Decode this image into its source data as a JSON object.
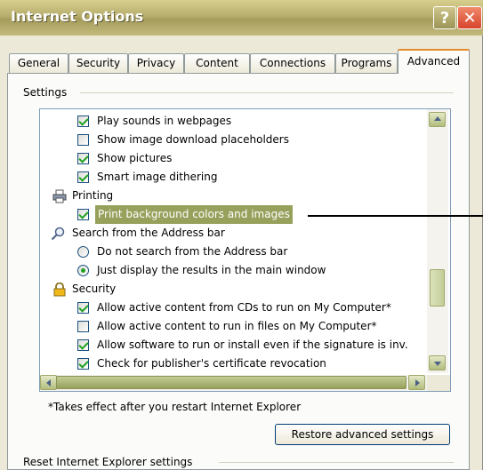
{
  "window": {
    "title": "Internet Options"
  },
  "titlebar_buttons": {
    "help_label": "?",
    "close_label": "✕"
  },
  "tabs": [
    {
      "label": "General"
    },
    {
      "label": "Security"
    },
    {
      "label": "Privacy"
    },
    {
      "label": "Content"
    },
    {
      "label": "Connections"
    },
    {
      "label": "Programs"
    },
    {
      "label": "Advanced"
    }
  ],
  "settings": {
    "group_label": "Settings",
    "items": [
      {
        "type": "checkbox",
        "checked": true,
        "label": "Play sounds in webpages"
      },
      {
        "type": "checkbox",
        "checked": false,
        "label": "Show image download placeholders"
      },
      {
        "type": "checkbox",
        "checked": true,
        "label": "Show pictures"
      },
      {
        "type": "checkbox",
        "checked": true,
        "label": "Smart image dithering"
      },
      {
        "type": "category",
        "icon": "printer-icon",
        "label": "Printing"
      },
      {
        "type": "checkbox",
        "checked": true,
        "label": "Print background colors and images",
        "selected": true
      },
      {
        "type": "category",
        "icon": "magnifier-icon",
        "label": "Search from the Address bar"
      },
      {
        "type": "radio",
        "checked": false,
        "label": "Do not search from the Address bar"
      },
      {
        "type": "radio",
        "checked": true,
        "label": "Just display the results in the main window"
      },
      {
        "type": "category",
        "icon": "padlock-icon",
        "label": "Security"
      },
      {
        "type": "checkbox",
        "checked": true,
        "label": "Allow active content from CDs to run on My Computer*"
      },
      {
        "type": "checkbox",
        "checked": false,
        "label": "Allow active content to run in files on My Computer*"
      },
      {
        "type": "checkbox",
        "checked": true,
        "label": "Allow software to run or install even if the signature is inv."
      },
      {
        "type": "checkbox",
        "checked": true,
        "label": "Check for publisher's certificate revocation"
      }
    ]
  },
  "note": "*Takes effect after you restart Internet Explorer",
  "restore_button": "Restore advanced settings",
  "reset_group_label": "Reset Internet Explorer settings",
  "colors": {
    "accent_tab": "#e68b2c",
    "selection": "#97a15c",
    "title_bar": "#b6ad6c"
  }
}
